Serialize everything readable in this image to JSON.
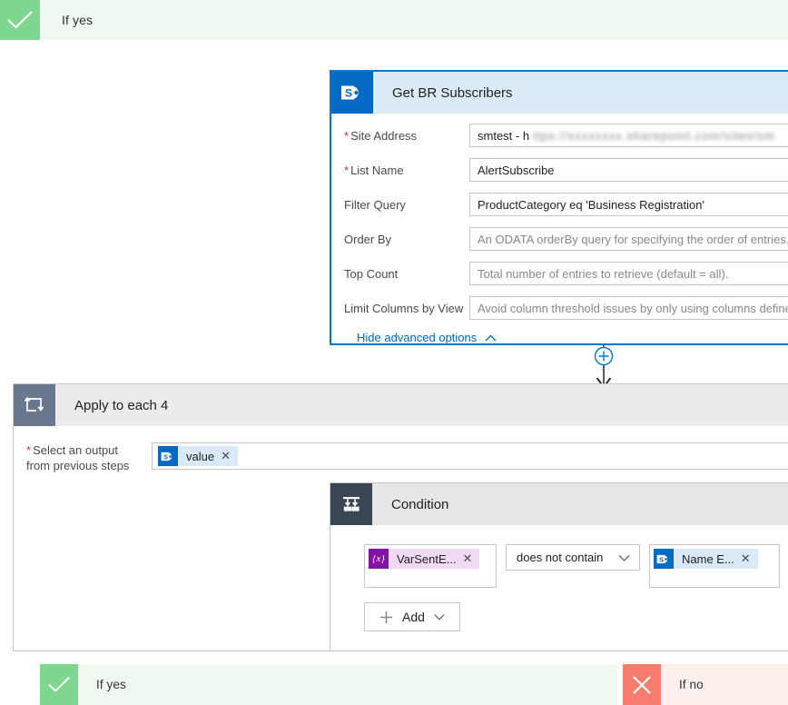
{
  "branch_top": {
    "label": "If yes",
    "icon": "check-icon",
    "icon_color": "#7FD78F",
    "body_color": "#EFF9F0"
  },
  "sharepoint_card": {
    "title": "Get BR Subscribers",
    "icon": "sharepoint-icon",
    "icon_color": "#036AC4",
    "header_color": "#DCEAF7",
    "selected_border_color": "#0078D4",
    "fields": [
      {
        "label": "Site Address",
        "required": true,
        "value": "smtest - h",
        "redacted_tail": "ttps://xxxxxxxx.sharepoint.com/sites/sm",
        "is_redacted": true,
        "state": "filled"
      },
      {
        "label": "List Name",
        "required": true,
        "value": "AlertSubscribe",
        "state": "filled"
      },
      {
        "label": "Filter Query",
        "required": false,
        "value": "ProductCategory eq 'Business Registration'",
        "state": "filled"
      },
      {
        "label": "Order By",
        "required": false,
        "value": "An ODATA orderBy query for specifying the order of entries.",
        "state": "placeholder"
      },
      {
        "label": "Top Count",
        "required": false,
        "value": "Total number of entries to retrieve (default = all).",
        "state": "placeholder"
      },
      {
        "label": "Limit Columns by View",
        "required": false,
        "value": "Avoid column threshold issues by only using columns defined in a view.",
        "state": "placeholder"
      }
    ],
    "advanced_toggle": {
      "label": "Hide advanced options",
      "icon": "chevron-up-icon",
      "color": "#0067B8"
    }
  },
  "connector": {
    "add_icon": "plus-circle-icon",
    "arrow_icon": "arrow-down-icon",
    "accent_color": "#0078D4"
  },
  "foreach_card": {
    "title": "Apply to each 4",
    "icon": "loop-icon",
    "icon_color": "#69788C",
    "header_color": "#EDEBE9",
    "field": {
      "label_line1": "Select an output",
      "label_line2": "from previous steps",
      "required": true,
      "token": {
        "text": "value",
        "icon": "sharepoint-icon",
        "remove_icon": "close-icon",
        "type": "sharepoint"
      }
    }
  },
  "condition_card": {
    "title": "Condition",
    "icon": "condition-icon",
    "icon_color": "#3B4654",
    "header_color": "#E6E6E6",
    "row": {
      "left_token": {
        "text": "VarSentE...",
        "icon": "variable-icon",
        "remove_icon": "close-icon",
        "type": "variable"
      },
      "operator": {
        "value": "does not contain",
        "icon": "chevron-down-icon"
      },
      "right_token": {
        "text": "Name E...",
        "icon": "sharepoint-icon",
        "remove_icon": "close-icon",
        "type": "sharepoint"
      }
    },
    "add_button": {
      "label": "Add",
      "plus_icon": "plus-icon",
      "chevron_icon": "chevron-down-icon"
    }
  },
  "branch_yes_bottom": {
    "label": "If yes",
    "icon": "check-icon",
    "icon_color": "#7FD78F",
    "body_color": "#EFF9F0"
  },
  "branch_no_bottom": {
    "label": "If no",
    "icon": "close-icon",
    "icon_color": "#F97D6E",
    "body_color": "#FDEFEC"
  }
}
